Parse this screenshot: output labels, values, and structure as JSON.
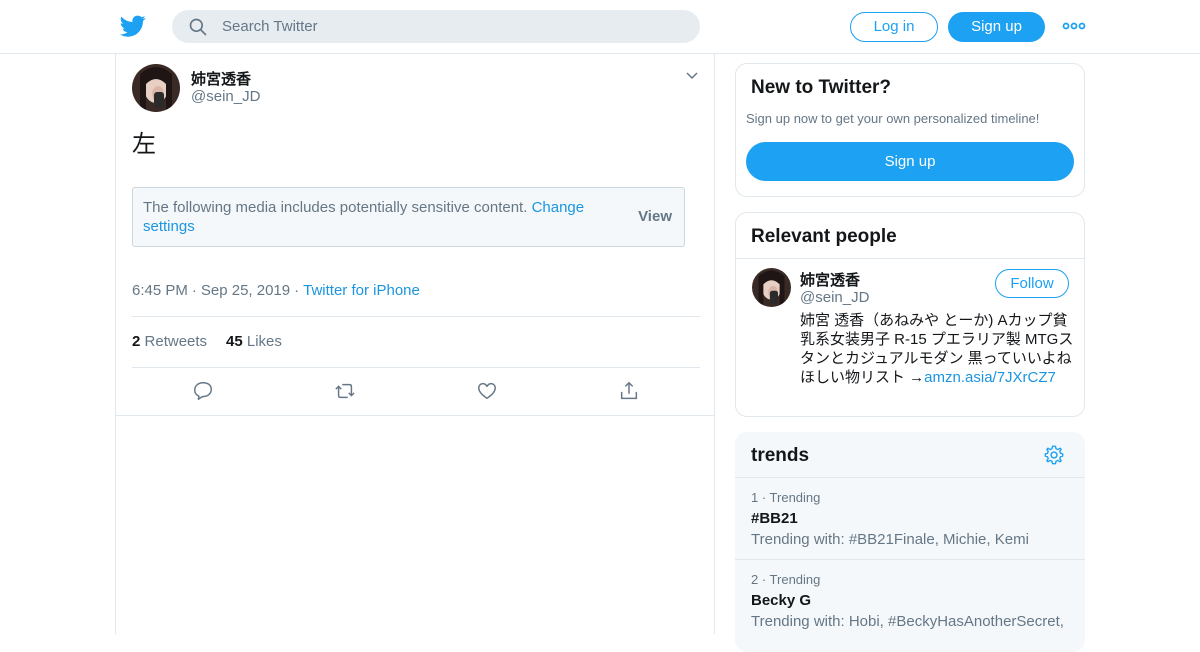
{
  "header": {
    "search_placeholder": "Search Twitter",
    "login_label": "Log in",
    "signup_label": "Sign up"
  },
  "tweet": {
    "name": "姉宮透香",
    "handle": "@sein_JD",
    "text": "左",
    "sensitive_message": "The following media includes potentially sensitive content.",
    "sensitive_link": "Change settings",
    "view_label": "View",
    "time": "6:45 PM",
    "date": "Sep 25, 2019",
    "source": "Twitter for iPhone",
    "retweets_count": "2",
    "retweets_label": "Retweets",
    "likes_count": "45",
    "likes_label": "Likes"
  },
  "sidebar": {
    "new_to_twitter": {
      "title": "New to Twitter?",
      "subtitle": "Sign up now to get your own personalized timeline!",
      "signup_label": "Sign up"
    },
    "relevant_people": {
      "title": "Relevant people",
      "name": "姉宮透香",
      "handle": "@sein_JD",
      "follow_label": "Follow",
      "bio_text": "姉宮 透香（あねみや とーか) Aカップ貧乳系女装男子 R-15 プエラリア製 MTGスタンとカジュアルモダン 黒っていいよね ほしい物リスト →",
      "bio_link": "amzn.asia/7JXrCZ7"
    },
    "trends": {
      "title": "trends",
      "items": [
        {
          "rank": "1 · Trending",
          "name": "#BB21",
          "with": "Trending with: #BB21Finale, Michie, Kemi"
        },
        {
          "rank": "2 · Trending",
          "name": "Becky G",
          "with": "Trending with: Hobi, #BeckyHasAnotherSecret,"
        }
      ]
    }
  },
  "colors": {
    "accent": "#1da1f2",
    "link": "#1b95e0",
    "muted": "#657786",
    "border": "#e1e8ed"
  }
}
